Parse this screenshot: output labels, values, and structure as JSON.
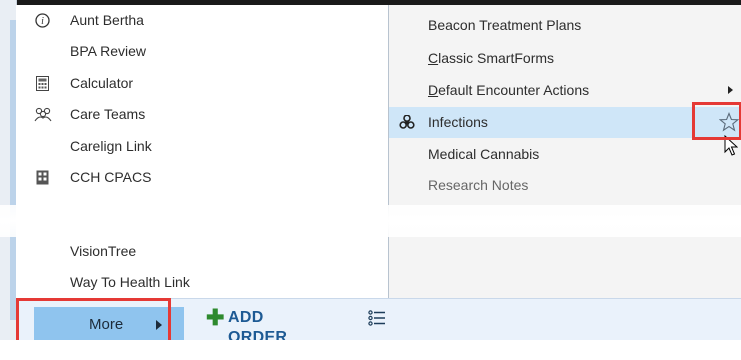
{
  "left_menu": [
    {
      "label": "Aunt Bertha",
      "icon": "info-icon"
    },
    {
      "label": "BPA Review",
      "icon": ""
    },
    {
      "label": "Calculator",
      "icon": "calculator-icon"
    },
    {
      "label": "Care Teams",
      "icon": "care-teams-icon"
    },
    {
      "label": "Carelign Link",
      "icon": ""
    },
    {
      "label": "CCH CPACS",
      "icon": "building-icon"
    },
    {
      "label": "VisionTree",
      "icon": ""
    },
    {
      "label": "Way To Health Link",
      "icon": ""
    }
  ],
  "right_menu": [
    {
      "label": "Beacon Treatment Plans",
      "icon": ""
    },
    {
      "label": "Classic SmartForms",
      "icon": ""
    },
    {
      "label": "Default Encounter Actions",
      "icon": "",
      "has_submenu": true
    },
    {
      "label": "Infections",
      "icon": "biohazard-icon",
      "selected": true
    },
    {
      "label": "Medical Cannabis",
      "icon": ""
    },
    {
      "label": "Research Notes",
      "icon": ""
    }
  ],
  "toolbar": {
    "more_label": "More",
    "add_order_label": "ADD ORDER"
  },
  "colors": {
    "selected_row": "#cfe6f8",
    "highlight_box": "#e53935",
    "more_button": "#8fc4ee",
    "add_order_text": "#1d5a94",
    "add_icon": "#2e8a2e"
  }
}
